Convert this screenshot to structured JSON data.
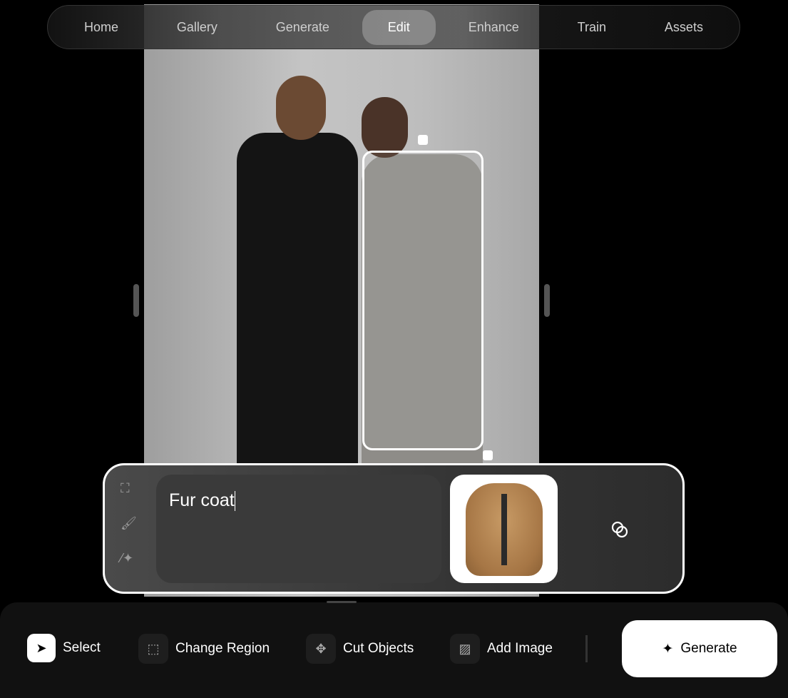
{
  "nav": {
    "tabs": [
      {
        "label": "Home"
      },
      {
        "label": "Gallery"
      },
      {
        "label": "Generate"
      },
      {
        "label": "Edit",
        "active": true
      },
      {
        "label": "Enhance"
      },
      {
        "label": "Train"
      },
      {
        "label": "Assets"
      }
    ]
  },
  "prompt": {
    "value": "Fur coat"
  },
  "panel": {
    "tool_icons": [
      "selection-frame-icon",
      "brush-icon",
      "magic-wand-icon"
    ],
    "reference_image": "fur-coat",
    "link_icon": "overlap-circles-icon"
  },
  "toolbar": {
    "items": [
      {
        "label": "Select",
        "icon": "cursor-icon",
        "active": true
      },
      {
        "label": "Change Region",
        "icon": "region-sparkle-icon"
      },
      {
        "label": "Cut Objects",
        "icon": "move-icon"
      },
      {
        "label": "Add Image",
        "icon": "image-add-icon"
      }
    ],
    "generate_label": "Generate"
  }
}
